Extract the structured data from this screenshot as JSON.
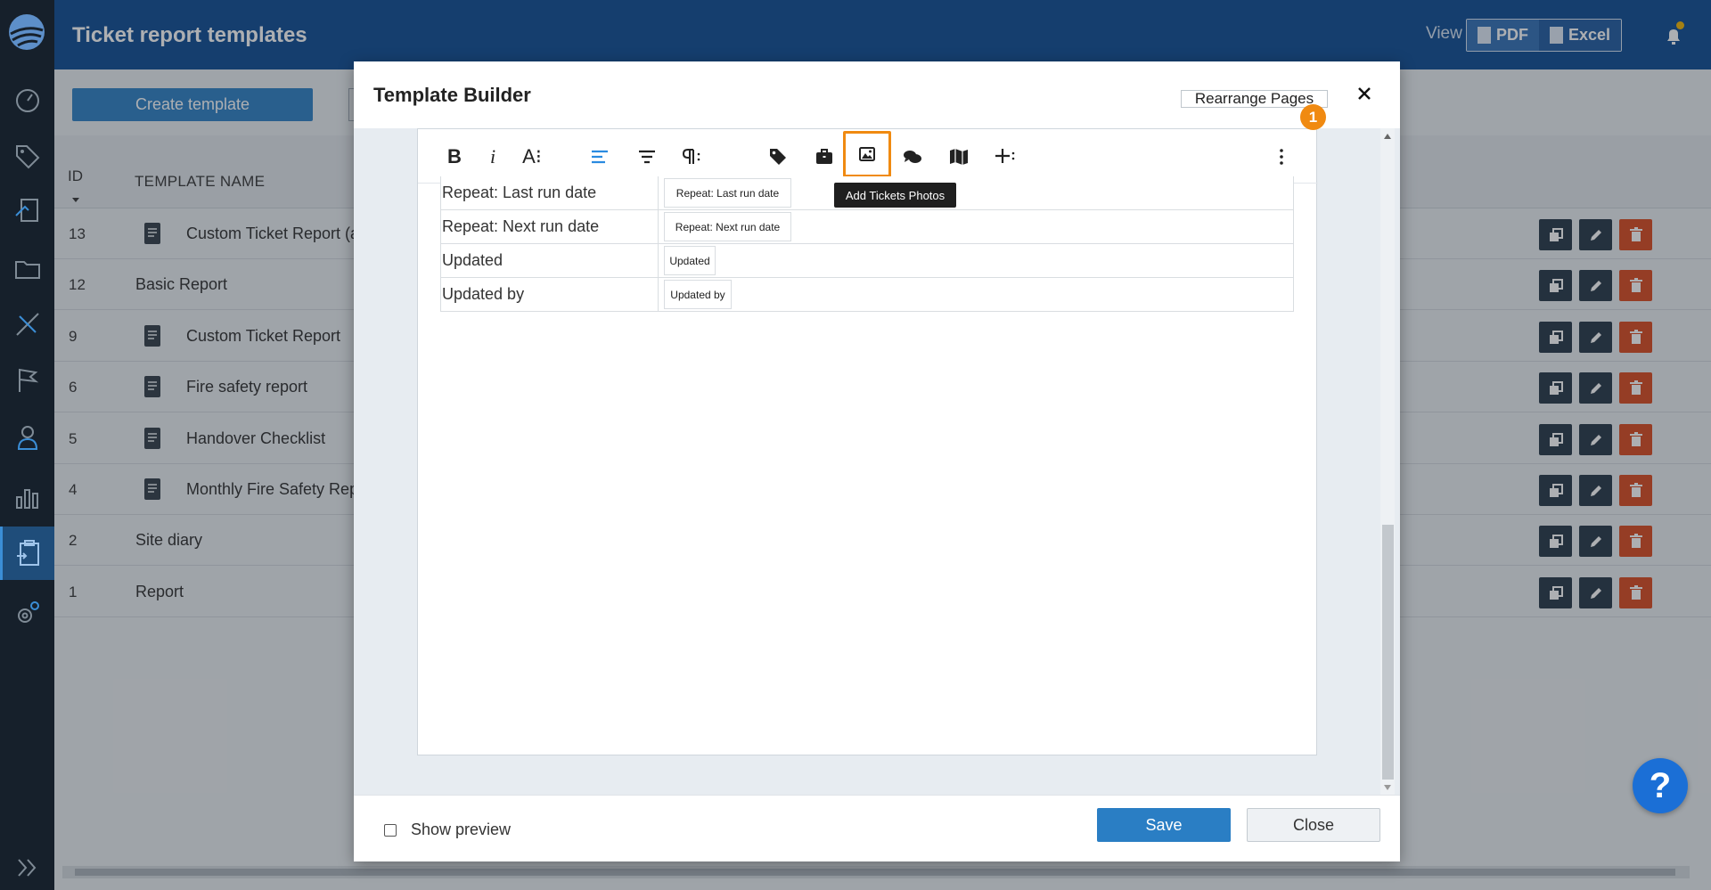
{
  "header": {
    "title": "Ticket report templates",
    "view_label": "View",
    "pdf_label": "PDF",
    "excel_label": "Excel"
  },
  "actions": {
    "create_label": "Create template"
  },
  "table": {
    "col_id": "ID",
    "col_name": "TEMPLATE NAME",
    "rows": [
      {
        "id": "13",
        "name": "Custom Ticket Report (al",
        "has_icon": true
      },
      {
        "id": "12",
        "name": "Basic Report",
        "has_icon": false
      },
      {
        "id": "9",
        "name": "Custom Ticket Report",
        "has_icon": true
      },
      {
        "id": "6",
        "name": "Fire safety report",
        "has_icon": true
      },
      {
        "id": "5",
        "name": "Handover Checklist",
        "has_icon": true
      },
      {
        "id": "4",
        "name": "Monthly Fire Safety Repo",
        "has_icon": true
      },
      {
        "id": "2",
        "name": "Site diary",
        "has_icon": false
      },
      {
        "id": "1",
        "name": "Report",
        "has_icon": false
      }
    ]
  },
  "modal": {
    "title": "Template Builder",
    "rearrange_label": "Rearrange Pages",
    "toolbar": {
      "bold": "B",
      "italic": "i",
      "font_size": "A⁝",
      "highlight_badge": "1",
      "tooltip": "Add Tickets Photos"
    },
    "fields": [
      {
        "label": "Repeat: Last run date",
        "chip": "Repeat: Last run date"
      },
      {
        "label": "Repeat: Next run date",
        "chip": "Repeat: Next run date"
      },
      {
        "label": "Updated",
        "chip": "Updated"
      },
      {
        "label": "Updated by",
        "chip": "Updated by"
      }
    ],
    "show_preview_label": "Show preview",
    "show_preview_checked": false,
    "save_label": "Save",
    "close_label": "Close"
  },
  "help_label": "?",
  "colors": {
    "header_bg": "#0a4a91",
    "sidebar_bg": "#16202b",
    "primary_button": "#2a7ec4",
    "delete_button": "#d8481c",
    "highlight": "#f08a11"
  }
}
